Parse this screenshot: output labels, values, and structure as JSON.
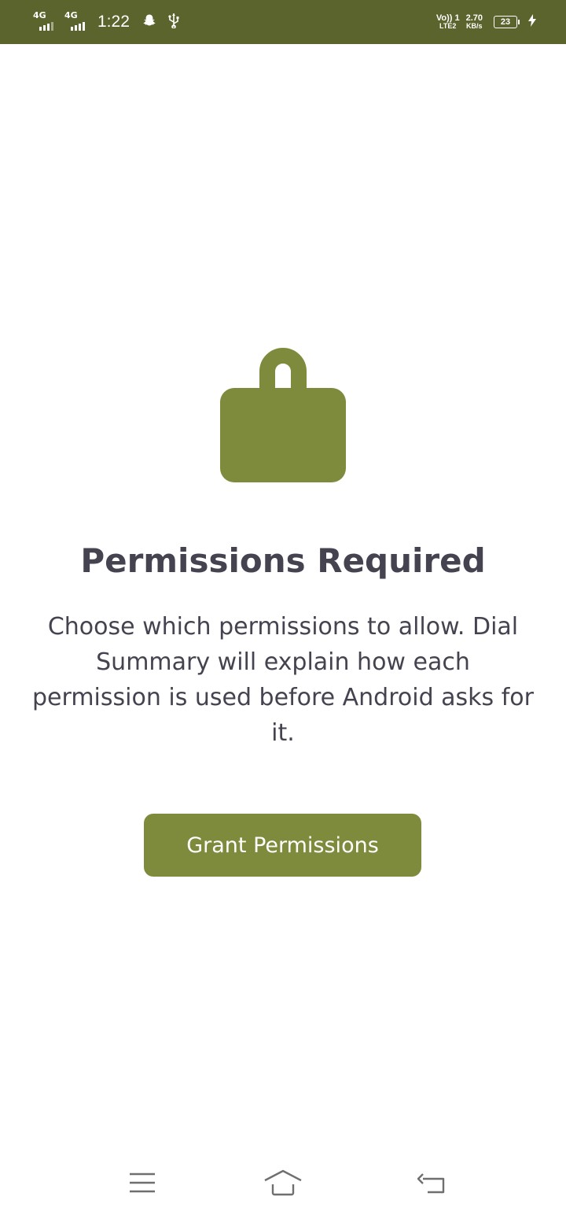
{
  "status_bar": {
    "sim1_label": "4G",
    "sim2_label": "4G",
    "time": "1:22",
    "volte_top": "Vo)) 1",
    "volte_bottom": "LTE2",
    "speed_value": "2.70",
    "speed_unit": "KB/s",
    "battery_level": "23",
    "icons": [
      "snapchat-icon",
      "usb-icon",
      "charging-icon"
    ],
    "background_color": "#5b642c"
  },
  "main": {
    "icon": "lock-icon",
    "title": "Permissions Required",
    "description": "Choose which permissions to allow. Dial Summary will explain how each permission is used before Android asks for it.",
    "grant_button_label": "Grant Permissions"
  },
  "nav_bar": {
    "buttons": [
      "menu-icon",
      "home-icon",
      "back-icon"
    ]
  },
  "colors": {
    "accent": "#7e8b3c",
    "text": "#45434f",
    "background": "#ffffff"
  }
}
